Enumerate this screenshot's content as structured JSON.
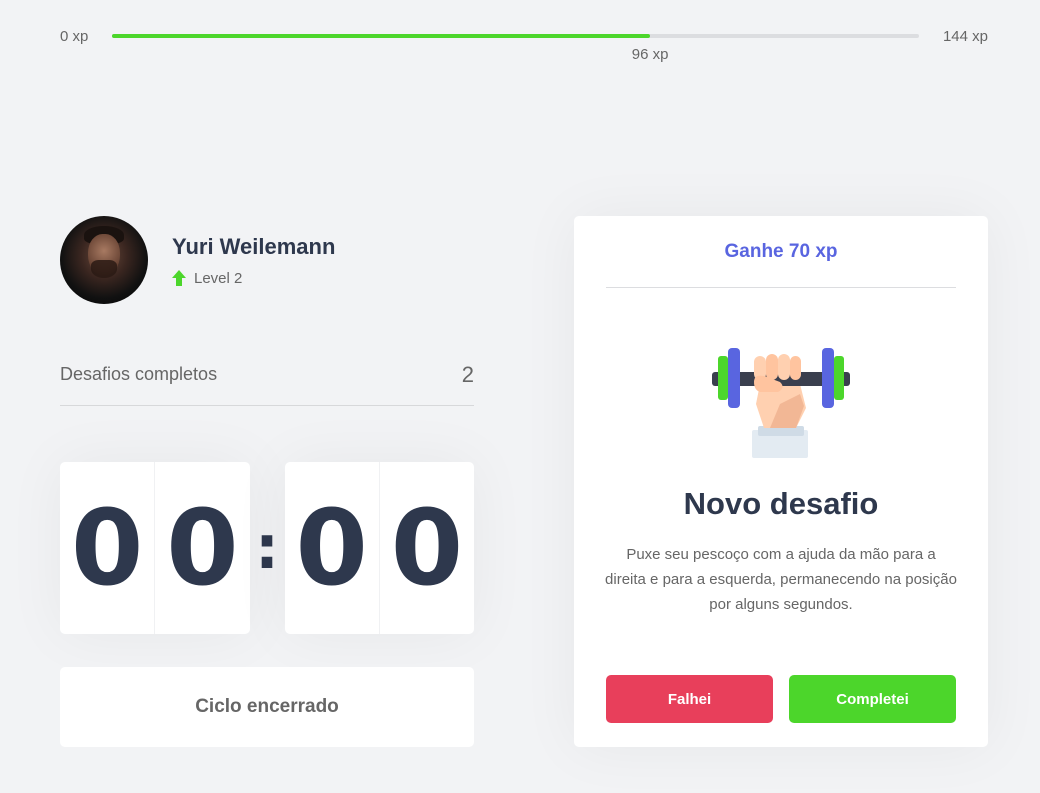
{
  "xp": {
    "min_label": "0 xp",
    "max_label": "144 xp",
    "current_label": "96 xp",
    "current": 96,
    "max": 144,
    "fill_color": "#4cd62b"
  },
  "profile": {
    "name": "Yuri Weilemann",
    "level_label": "Level 2"
  },
  "completed_challenges": {
    "label": "Desafios completos",
    "count": "2"
  },
  "countdown": {
    "minute_left": "0",
    "minute_right": "0",
    "separator": ":",
    "second_left": "0",
    "second_right": "0"
  },
  "cycle_button": {
    "label": "Ciclo encerrado"
  },
  "challenge": {
    "reward": "Ganhe 70 xp",
    "icon": "body-dumbbell-icon",
    "title": "Novo desafio",
    "description": "Puxe seu pescoço com a ajuda da mão para a direita e para a esquerda, permanecendo na posição por alguns segundos.",
    "fail_label": "Falhei",
    "success_label": "Completei"
  },
  "colors": {
    "accent_blue": "#5965e0",
    "green": "#4cd62b",
    "red": "#e83f5b",
    "title": "#2e384d"
  }
}
